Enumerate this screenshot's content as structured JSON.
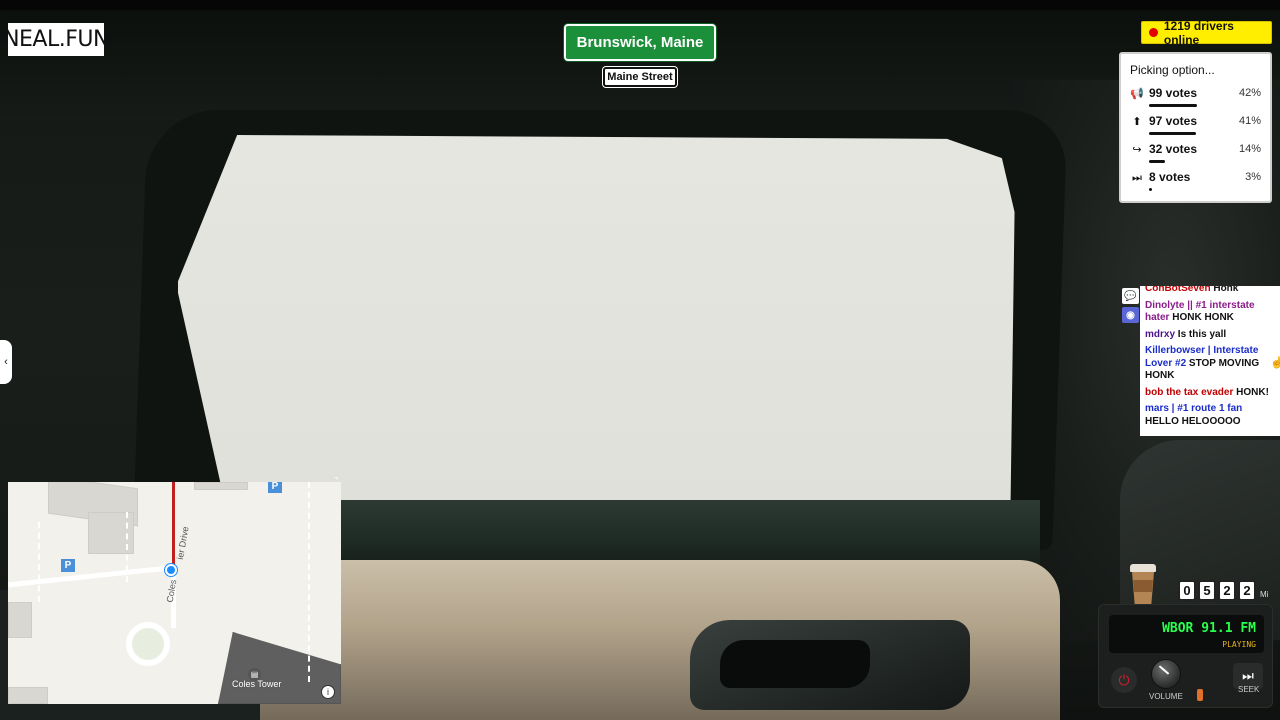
{
  "logo": "NEAL.FUN",
  "signs": {
    "city": "Brunswick, Maine",
    "street": "Maine Street"
  },
  "online": {
    "text": "1219 drivers online",
    "dot_color": "#e30000",
    "badge_color": "#ffee00"
  },
  "vote": {
    "title": "Picking option...",
    "options": [
      {
        "icon": "horn-icon",
        "glyph": "📢",
        "votes": "99 votes",
        "percent": "42%",
        "fraction": 0.42
      },
      {
        "icon": "arrow-up-icon",
        "glyph": "⬆",
        "votes": "97 votes",
        "percent": "41%",
        "fraction": 0.41
      },
      {
        "icon": "turn-icon",
        "glyph": "↪",
        "votes": "32 votes",
        "percent": "14%",
        "fraction": 0.14
      },
      {
        "icon": "skip-icon",
        "glyph": "⏭",
        "votes": "8 votes",
        "percent": "3%",
        "fraction": 0.03
      }
    ]
  },
  "chat": {
    "messages": [
      {
        "user": "ConBotSeven",
        "color": "#c00000",
        "text": "Honk"
      },
      {
        "user": "Dinolyte || #1 interstate hater",
        "color": "#8a1d8a",
        "text": "HONK HONK"
      },
      {
        "user": "mdrxy",
        "color": "#4b148a",
        "text": "Is this yall"
      },
      {
        "user": "Killerbowser | Interstate Lover #2",
        "color": "#1a2dc9",
        "text": "STOP MOVING HONK"
      },
      {
        "user": "bob the tax evader",
        "color": "#c00000",
        "text": "HONK!"
      },
      {
        "user": "mars | #1 route 1 fan",
        "color": "#1a2dc9",
        "text": "HELLO HELOOOOO"
      }
    ]
  },
  "map": {
    "road_label_1": "ier Drive",
    "road_label_2": "Coles",
    "poi": "Coles Tower",
    "parking": "P",
    "info": "i"
  },
  "odometer": {
    "digits": [
      "0",
      "5",
      "2",
      "2"
    ],
    "unit": "Mi"
  },
  "radio": {
    "station": "WBOR 91.1 FM",
    "status": "PLAYING",
    "volume_label": "VOLUME",
    "seek_label": "SEEK",
    "station_color": "#29ff4d",
    "status_color": "#e7b21c"
  }
}
